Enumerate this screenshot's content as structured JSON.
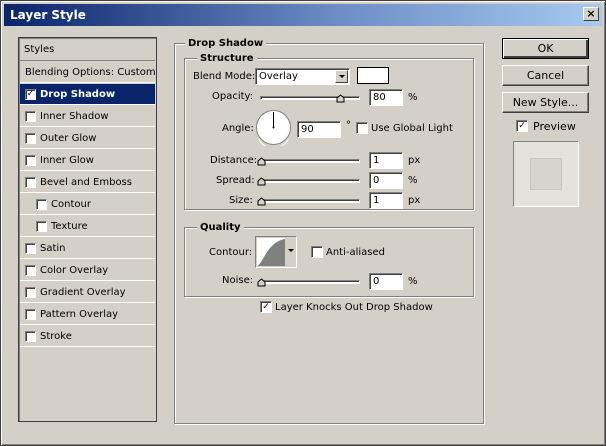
{
  "window": {
    "title": "Layer Style",
    "close_glyph": "×"
  },
  "styles_list": {
    "header": "Styles",
    "items": [
      {
        "label": "Blending Options: Custom",
        "checkbox": false,
        "checked": false,
        "selected": false,
        "indent": false
      },
      {
        "label": "Drop Shadow",
        "checkbox": true,
        "checked": true,
        "selected": true,
        "indent": false
      },
      {
        "label": "Inner Shadow",
        "checkbox": true,
        "checked": false,
        "selected": false,
        "indent": false
      },
      {
        "label": "Outer Glow",
        "checkbox": true,
        "checked": false,
        "selected": false,
        "indent": false
      },
      {
        "label": "Inner Glow",
        "checkbox": true,
        "checked": false,
        "selected": false,
        "indent": false
      },
      {
        "label": "Bevel and Emboss",
        "checkbox": true,
        "checked": false,
        "selected": false,
        "indent": false
      },
      {
        "label": "Contour",
        "checkbox": true,
        "checked": false,
        "selected": false,
        "indent": true
      },
      {
        "label": "Texture",
        "checkbox": true,
        "checked": false,
        "selected": false,
        "indent": true
      },
      {
        "label": "Satin",
        "checkbox": true,
        "checked": false,
        "selected": false,
        "indent": false
      },
      {
        "label": "Color Overlay",
        "checkbox": true,
        "checked": false,
        "selected": false,
        "indent": false
      },
      {
        "label": "Gradient Overlay",
        "checkbox": true,
        "checked": false,
        "selected": false,
        "indent": false
      },
      {
        "label": "Pattern Overlay",
        "checkbox": true,
        "checked": false,
        "selected": false,
        "indent": false
      },
      {
        "label": "Stroke",
        "checkbox": true,
        "checked": false,
        "selected": false,
        "indent": false
      }
    ]
  },
  "drop_shadow": {
    "title": "Drop Shadow",
    "structure": {
      "title": "Structure",
      "blend_mode_label": "Blend Mode:",
      "blend_mode_value": "Overlay",
      "shadow_color": "#ffffff",
      "opacity_label": "Opacity:",
      "opacity_value": "80",
      "opacity_unit": "%",
      "opacity_level": 0.8,
      "angle_label": "Angle:",
      "angle_value": "90",
      "angle_unit": "°",
      "global_light_label": "Use Global Light",
      "global_light_checked": false,
      "distance_label": "Distance:",
      "distance_value": "1",
      "distance_unit": "px",
      "spread_label": "Spread:",
      "spread_value": "0",
      "spread_unit": "%",
      "size_label": "Size:",
      "size_value": "1",
      "size_unit": "px"
    },
    "quality": {
      "title": "Quality",
      "contour_label": "Contour:",
      "anti_aliased_label": "Anti-aliased",
      "anti_aliased_checked": false,
      "noise_label": "Noise:",
      "noise_value": "0",
      "noise_unit": "%"
    },
    "knockout_label": "Layer Knocks Out Drop Shadow",
    "knockout_checked": true
  },
  "buttons": {
    "ok": "OK",
    "cancel": "Cancel",
    "new_style": "New Style...",
    "preview_label": "Preview",
    "preview_checked": true
  },
  "colors": {
    "dialog_bg": "#d4d0c8",
    "titlebar_start": "#0a246a",
    "titlebar_end": "#a6caf0",
    "selection": "#0a246a"
  }
}
